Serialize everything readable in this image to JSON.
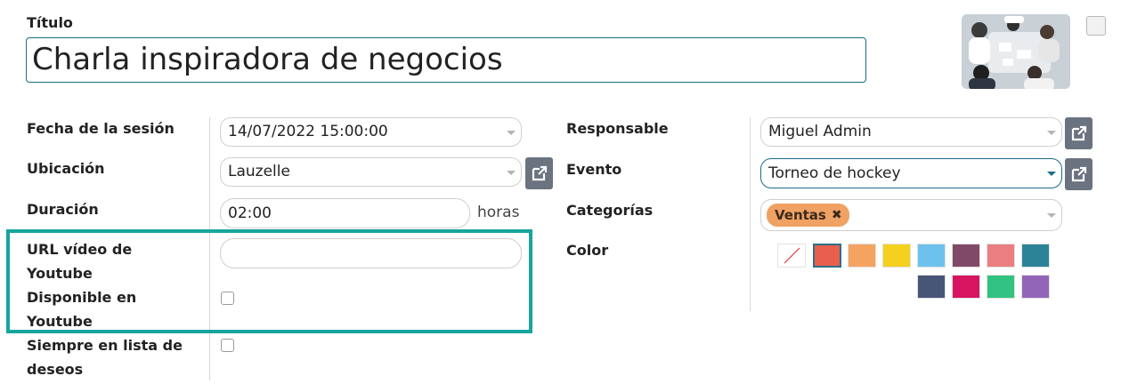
{
  "title": {
    "label": "Título",
    "value": "Charla inspiradora de negocios"
  },
  "left": {
    "fecha": {
      "label": "Fecha de la sesión",
      "value": "14/07/2022 15:00:00"
    },
    "ubicacion": {
      "label": "Ubicación",
      "value": "Lauzelle"
    },
    "duracion": {
      "label": "Duración",
      "value": "02:00",
      "unit": "horas"
    },
    "youtube_url": {
      "label_line1": "URL vídeo de",
      "label_line2": "Youtube",
      "value": ""
    },
    "youtube_disponible": {
      "label_line1": "Disponible en",
      "label_line2": "Youtube",
      "checked": false
    },
    "wishlist": {
      "label_line1": "Siempre en lista de",
      "label_line2": "deseos",
      "checked": false
    }
  },
  "right": {
    "responsable": {
      "label": "Responsable",
      "value": "Miguel Admin"
    },
    "evento": {
      "label": "Evento",
      "value": "Torneo de hockey"
    },
    "categorias": {
      "label": "Categorías",
      "tags": [
        "Ventas"
      ]
    },
    "color": {
      "label": "Color",
      "swatches": [
        "none",
        "#e8604c",
        "#f4a460",
        "#f5d01e",
        "#6cc1ed",
        "#814968",
        "#eb7e7f",
        "#2c8397",
        "#475577",
        "#d6145f",
        "#30c381",
        "#9365b8"
      ],
      "selected_index": 1
    }
  },
  "icons": {
    "external_link": "external-link-icon",
    "dropdown": "chevron-down-icon",
    "remove_tag": "close-icon"
  }
}
